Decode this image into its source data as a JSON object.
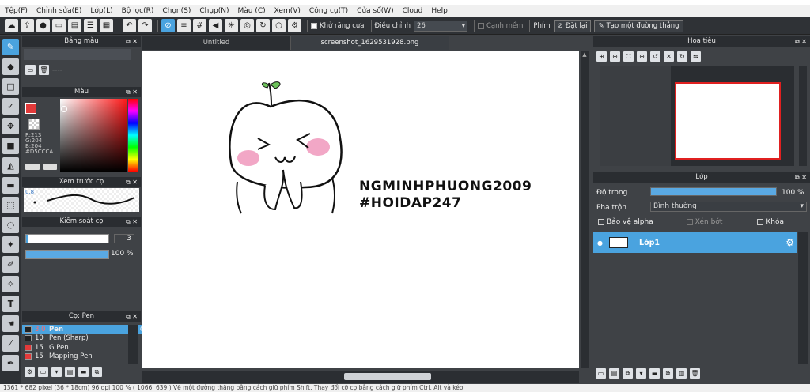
{
  "menu": [
    "Tệp(F)",
    "Chỉnh sửa(E)",
    "Lớp(L)",
    "Bộ lọc(R)",
    "Chọn(S)",
    "Chụp(N)",
    "Màu (C)",
    "Xem(V)",
    "Công cụ(T)",
    "Cửa sổ(W)",
    "Cloud",
    "Help"
  ],
  "toolbar": {
    "antialias_label": "Khử răng cưa",
    "adjust_label": "Điều chỉnh",
    "adjust_value": "26",
    "smooth_label": "Cạnh mềm",
    "key_label": "Phím",
    "reset_label": "Đặt lại",
    "straight_label": "Tạo một đường thẳng"
  },
  "panels": {
    "palette": {
      "title": "Bảng màu",
      "dash": "----"
    },
    "color": {
      "title": "Màu",
      "r": "R:213",
      "g": "G:204",
      "b": "B:204",
      "hex": "#D5CCCA"
    },
    "preview": {
      "title": "Xem trước cọ",
      "size": "0.8"
    },
    "brush_control": {
      "title": "Kiểm soát cọ",
      "size_value": "3",
      "opacity_value": "100 %",
      "opacity_fraction": 1.0
    },
    "brush": {
      "title": "Cọ: Pen",
      "items": [
        {
          "size": "3.0",
          "name": "Pen",
          "color": "#222222",
          "selected": true
        },
        {
          "size": "10",
          "name": "Pen (Sharp)",
          "color": "#222222",
          "selected": false
        },
        {
          "size": "15",
          "name": "G Pen",
          "color": "#e23a3a",
          "selected": false
        },
        {
          "size": "15",
          "name": "Mapping Pen",
          "color": "#e23a3a",
          "selected": false
        }
      ]
    },
    "navigator": {
      "title": "Hoa tiêu"
    },
    "layer": {
      "title": "Lớp",
      "opacity_label": "Độ trong",
      "opacity_value": "100 %",
      "opacity_fraction": 1.0,
      "blend_label": "Pha trộn",
      "blend_value": "Bình thường",
      "protect_alpha": "Bảo vệ alpha",
      "clip": "Xén bớt",
      "lock": "Khóa",
      "layer_name": "Lớp1"
    }
  },
  "tabs": {
    "untitled": "Untitled",
    "screenshot": "screenshot_1629531928.png"
  },
  "artwork": {
    "line1": "NGMINHPHUONG2009",
    "line2": "#HOIDAP247"
  },
  "status": "1361 * 682 pixel (36 * 18cm) 96 dpi 100 % ( 1066, 639 ) Vẽ một đường thẳng bằng cách giữ phím Shift. Thay đổi cỡ cọ bằng cách giữ phím Ctrl, Alt và kéo",
  "colors": {
    "accent": "#4aa3df",
    "primary_swatch": "#e23a3a",
    "panel_bg": "#3f4246"
  }
}
